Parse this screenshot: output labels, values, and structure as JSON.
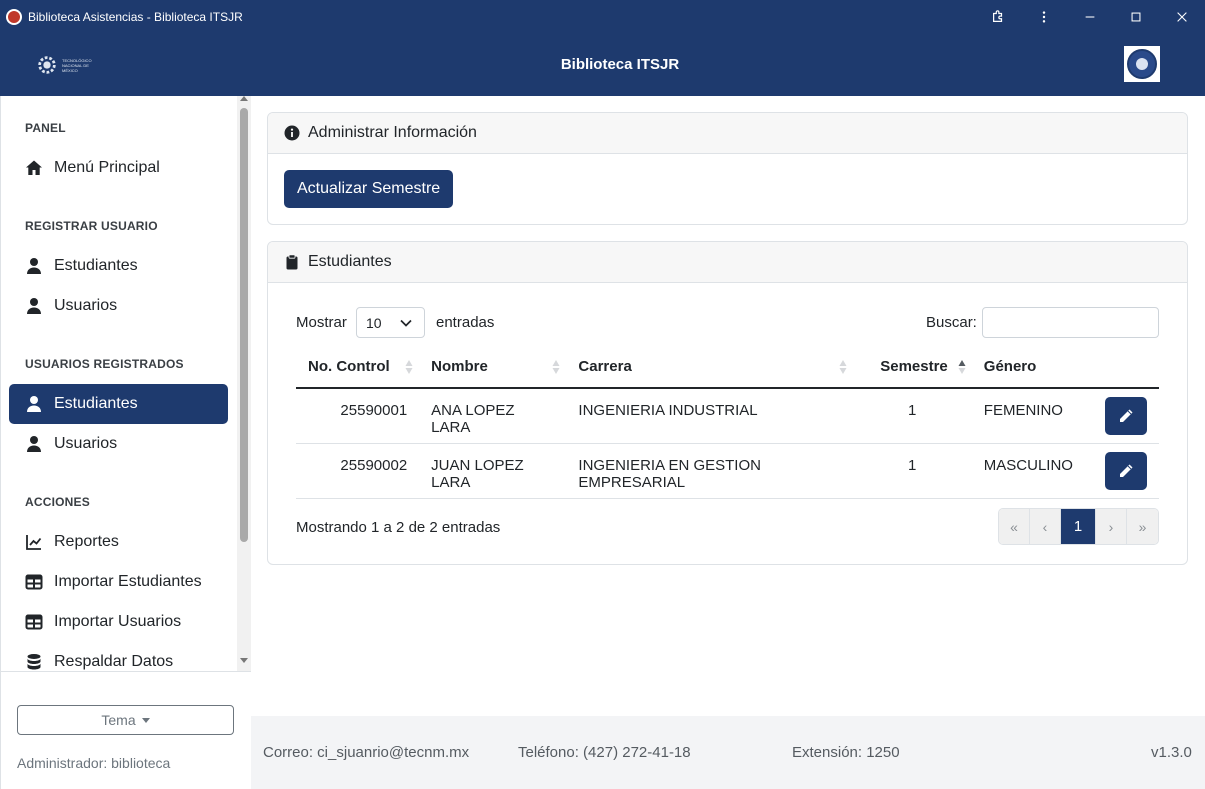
{
  "window": {
    "title": "Biblioteca Asistencias - Biblioteca ITSJR"
  },
  "header": {
    "brand": "Biblioteca ITSJR",
    "logo_left_text": "TECNOLÓGICO NACIONAL DE MÉXICO"
  },
  "sidebar": {
    "sections": {
      "panel": "PANEL",
      "registrar": "REGISTRAR USUARIO",
      "registrados": "USUARIOS REGISTRADOS",
      "acciones": "ACCIONES"
    },
    "items": {
      "menu_principal": "Menú Principal",
      "reg_estudiantes": "Estudiantes",
      "reg_usuarios": "Usuarios",
      "list_estudiantes": "Estudiantes",
      "list_usuarios": "Usuarios",
      "reportes": "Reportes",
      "importar_estudiantes": "Importar Estudiantes",
      "importar_usuarios": "Importar Usuarios",
      "respaldar_datos": "Respaldar Datos"
    },
    "tema_label": "Tema",
    "admin_label": "Administrador: biblioteca"
  },
  "admin_card": {
    "title": "Administrar Información",
    "button": "Actualizar Semestre"
  },
  "students_card": {
    "title": "Estudiantes",
    "length_prefix": "Mostrar",
    "length_value": "10",
    "length_suffix": "entradas",
    "search_label": "Buscar:",
    "search_value": "",
    "columns": [
      "No. Control",
      "Nombre",
      "Carrera",
      "Semestre",
      "Género"
    ],
    "rows": [
      {
        "control": "25590001",
        "nombre": "ANA LOPEZ LARA",
        "carrera": "INGENIERIA INDUSTRIAL",
        "semestre": "1",
        "genero": "FEMENINO"
      },
      {
        "control": "25590002",
        "nombre": "JUAN LOPEZ LARA",
        "carrera": "INGENIERIA EN GESTION EMPRESARIAL",
        "semestre": "1",
        "genero": "MASCULINO"
      }
    ],
    "info": "Mostrando 1 a 2 de 2 entradas",
    "pagination": {
      "first": "«",
      "prev": "‹",
      "current": "1",
      "next": "›",
      "last": "»"
    }
  },
  "footer": {
    "email": "Correo: ci_sjuanrio@tecnm.mx",
    "phone": "Teléfono: (427) 272-41-18",
    "extension": "Extensión: 1250",
    "version": "v1.3.0"
  },
  "colors": {
    "primary": "#1e3a6e"
  }
}
